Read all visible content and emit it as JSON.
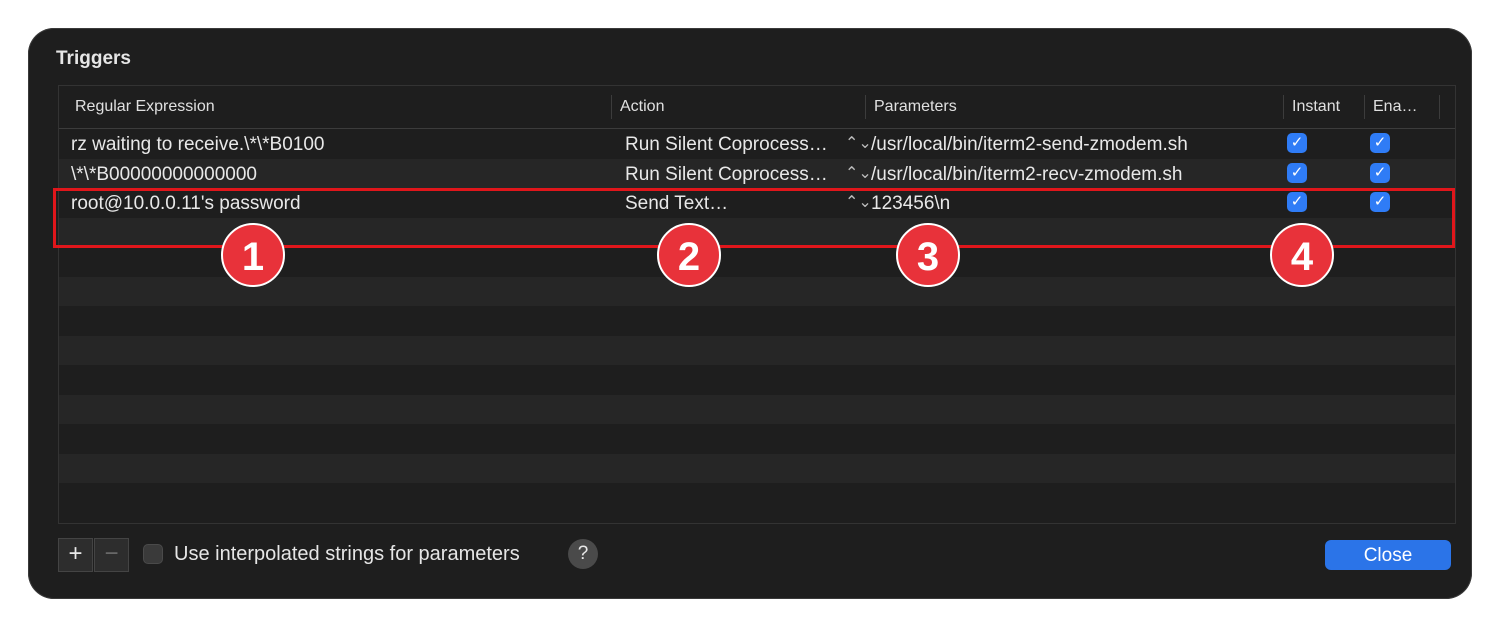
{
  "window": {
    "title": "Triggers"
  },
  "table": {
    "columns": [
      "Regular Expression",
      "Action",
      "Parameters",
      "Instant",
      "Ena…"
    ],
    "rows": [
      {
        "regex": "rz waiting to receive.\\*\\*B0100",
        "action": "Run Silent Coprocess…",
        "parameters": "/usr/local/bin/iterm2-send-zmodem.sh",
        "instant": true,
        "enabled": true
      },
      {
        "regex": "\\*\\*B00000000000000",
        "action": "Run Silent Coprocess…",
        "parameters": "/usr/local/bin/iterm2-recv-zmodem.sh",
        "instant": true,
        "enabled": true
      },
      {
        "regex": "root@10.0.0.11's password",
        "action": "Send Text…",
        "parameters": "123456\\n",
        "instant": true,
        "enabled": true
      }
    ],
    "stepper_glyph": "⌃⌄",
    "check_glyph": "✓"
  },
  "annotations": [
    "1",
    "2",
    "3",
    "4"
  ],
  "footer": {
    "add_label": "+",
    "remove_label": "−",
    "interpolated_label": "Use interpolated strings for parameters",
    "help_label": "?",
    "close_label": "Close"
  },
  "colors": {
    "accent": "#2b74e8",
    "highlight": "#e0161b",
    "badge": "#e8323a"
  }
}
